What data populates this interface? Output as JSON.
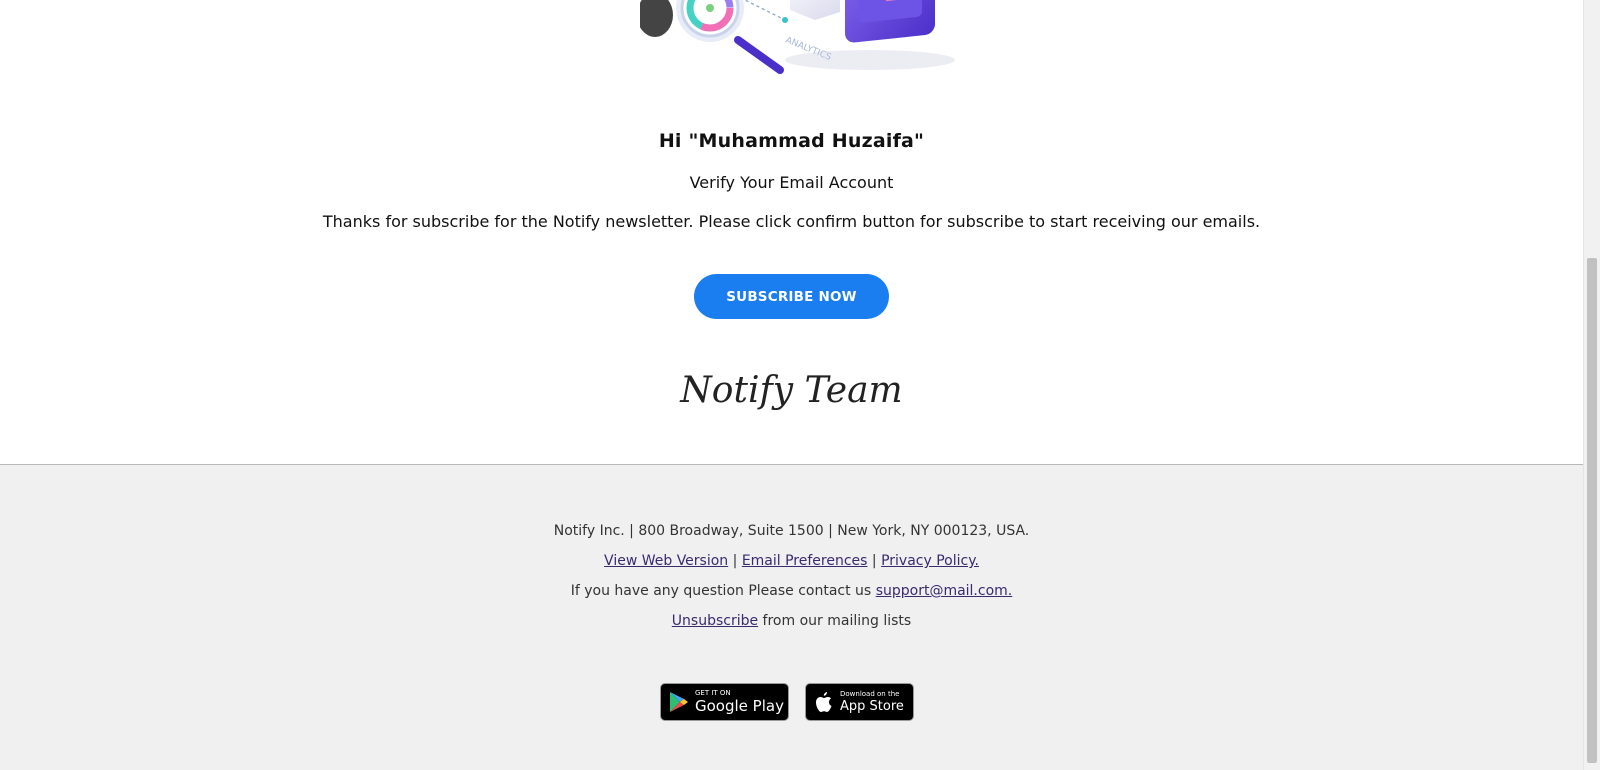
{
  "email": {
    "greeting": "Hi \"Muhammad Huzaifa\"",
    "subheading": "Verify Your Email Account",
    "body": "Thanks for subscribe for the Notify newsletter. Please click confirm button for subscribe to start receiving our emails.",
    "cta_label": "SUBSCRIBE NOW",
    "signature": "Notify Team",
    "hero_illustration_text": "ANALYTICS"
  },
  "footer": {
    "address": "Notify Inc. | 800 Broadway, Suite 1500 | New York, NY 000123, USA.",
    "links": {
      "web_version": "View Web Version",
      "sep1": " | ",
      "email_preferences": "Email Preferences",
      "sep2": " | ",
      "privacy": "Privacy Policy."
    },
    "contact_prefix": "If you have any question Please contact us ",
    "contact_email": "support@mail.com.",
    "unsubscribe_link": "Unsubscribe",
    "unsubscribe_suffix": " from our mailing lists",
    "badges": {
      "google_small": "GET IT ON",
      "google_big": "Google Play",
      "apple_small": "Download on the",
      "apple_big": "App Store"
    }
  },
  "colors": {
    "cta": "#1a7df0",
    "footer_bg": "#f0f0f0",
    "link": "#3a2a6e"
  },
  "icons": [
    "analytics-illustration",
    "google-play-icon",
    "apple-icon"
  ]
}
